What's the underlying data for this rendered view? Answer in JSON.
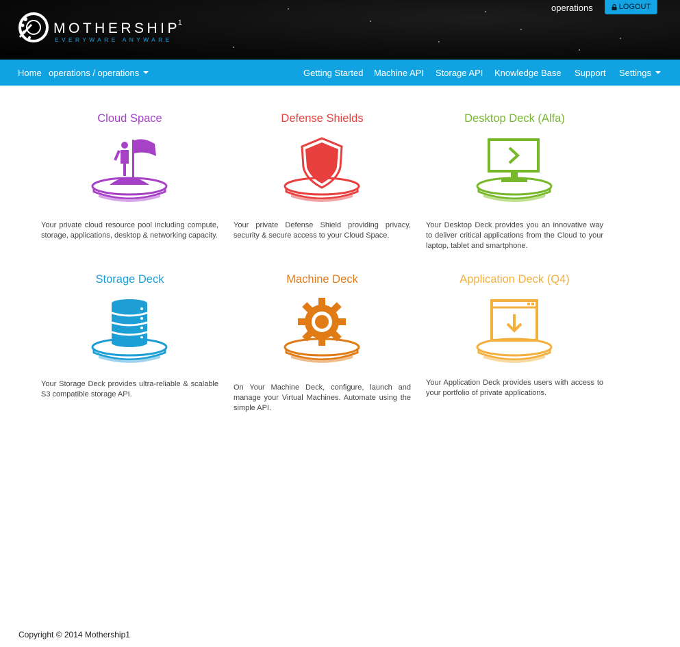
{
  "header": {
    "brand_name": "MOTHERSHIP",
    "brand_sup": "1",
    "brand_tagline": "EVERYWARE ANYWARE",
    "user": "operations",
    "logout_label": "LOGOUT"
  },
  "nav": {
    "home": "Home",
    "space_selector": "operations / operations",
    "getting_started": "Getting Started",
    "machine_api": "Machine API",
    "storage_api": "Storage API",
    "knowledge_base": "Knowledge Base",
    "support": "Support",
    "settings": "Settings"
  },
  "tiles": [
    {
      "title": "Cloud Space",
      "color": "#a742c6",
      "icon": "flag-summit-icon",
      "desc": "Your private cloud resource pool including compute, storage, applications, desktop & networking capacity."
    },
    {
      "title": "Defense Shields",
      "color": "#e8403f",
      "icon": "shield-icon",
      "desc": "Your private Defense Shield providing privacy, security & secure access to your Cloud Space."
    },
    {
      "title": "Desktop Deck (Alfa)",
      "color": "#76b82a",
      "icon": "monitor-icon",
      "desc": "Your Desktop Deck provides you an innovative way to deliver critical applications from the Cloud to your laptop, tablet and smartphone."
    },
    {
      "title": "Storage Deck",
      "color": "#1d9fd6",
      "icon": "database-icon",
      "desc": "Your Storage Deck provides ultra-reliable & scalable S3 compatible storage API."
    },
    {
      "title": "Machine Deck",
      "color": "#e07b16",
      "icon": "gear-icon",
      "desc": "On Your Machine Deck, configure, launch and manage your Virtual Machines. Automate using the simple API."
    },
    {
      "title": "Application Deck (Q4)",
      "color": "#f4b03e",
      "icon": "app-download-icon",
      "desc": "Your Application Deck provides users with access to your portfolio of private applications."
    }
  ],
  "footer": {
    "copyright": "Copyright © 2014 Mothership1"
  }
}
